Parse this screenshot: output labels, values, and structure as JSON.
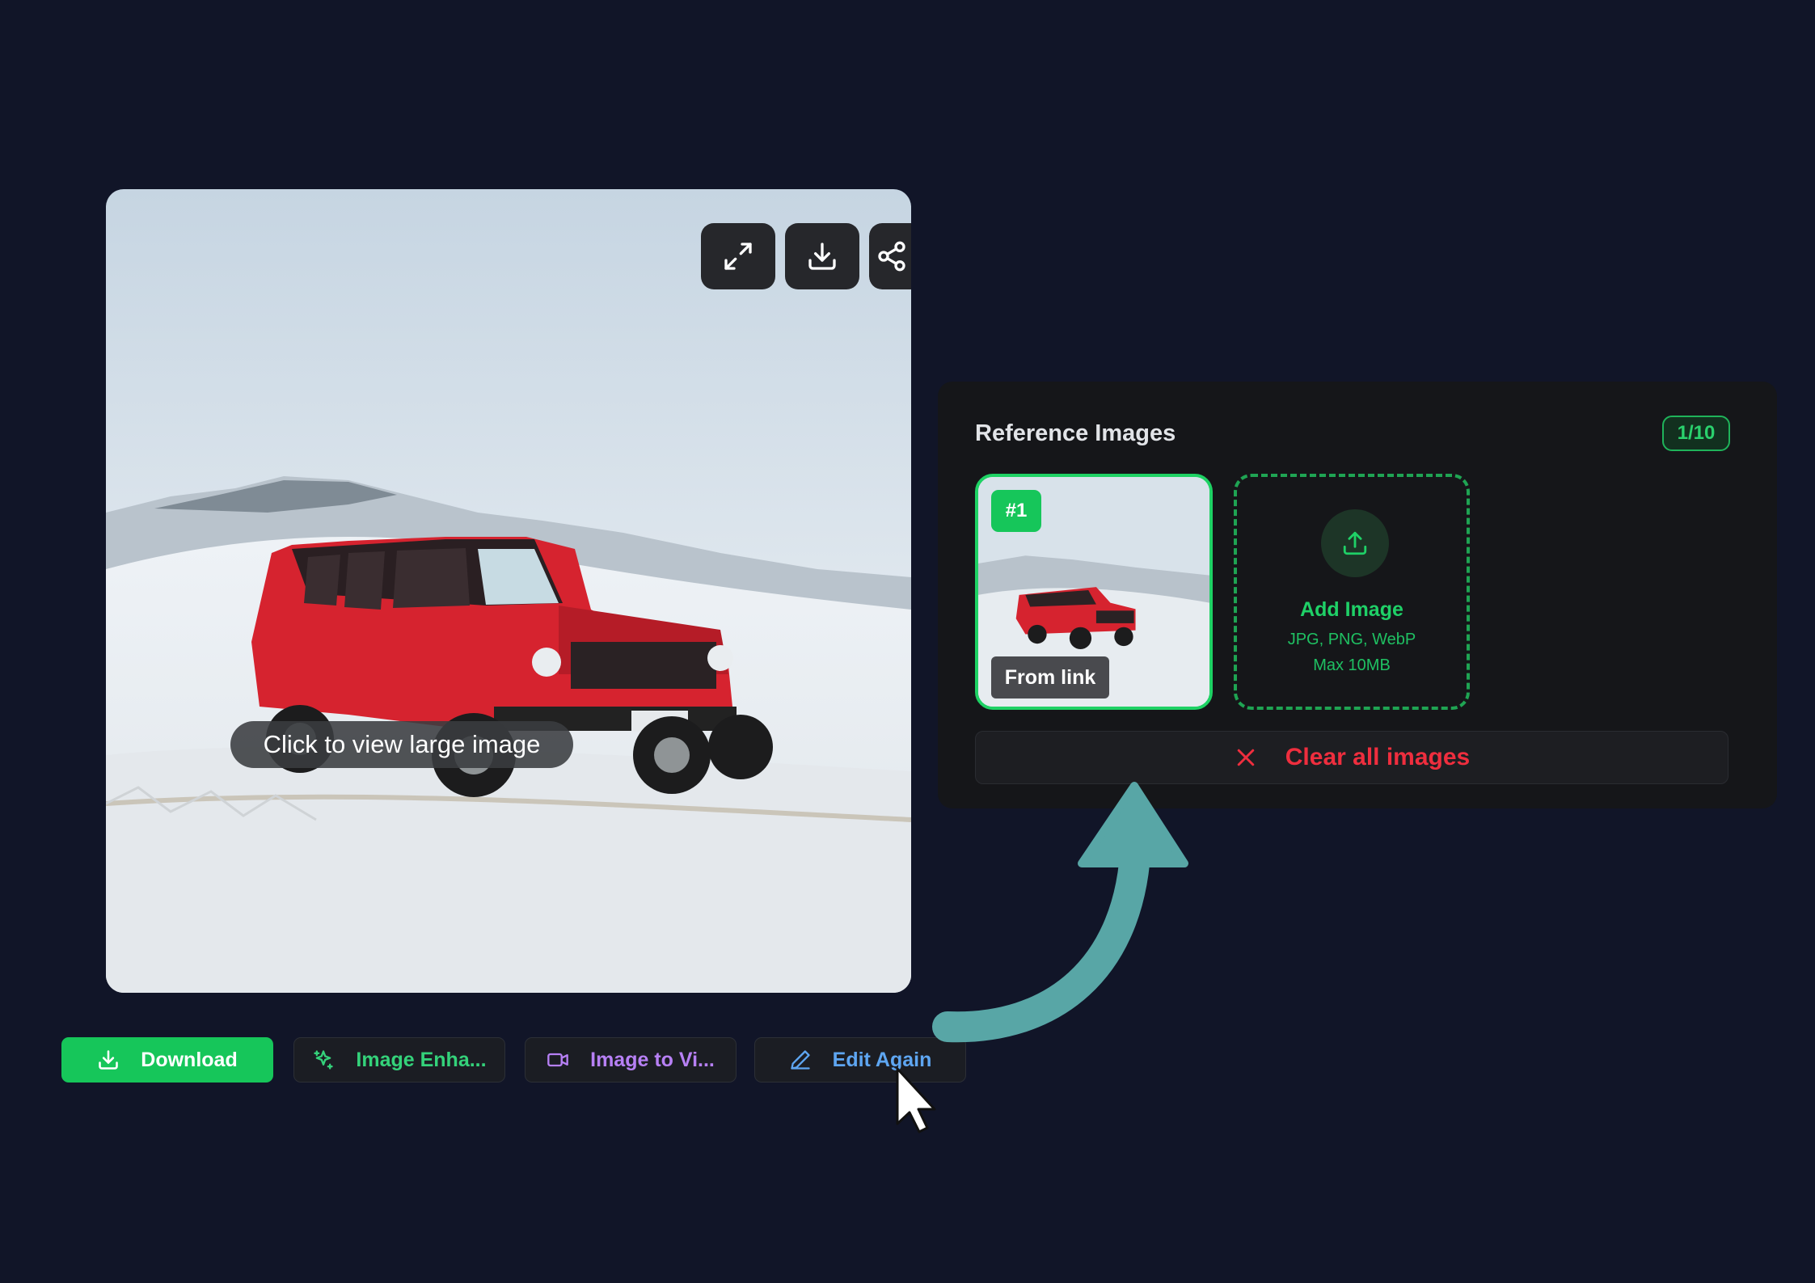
{
  "main_image": {
    "view_label": "Click to view large image",
    "tools": [
      {
        "icon": "expand-icon"
      },
      {
        "icon": "download-icon"
      },
      {
        "icon": "share-icon"
      }
    ]
  },
  "actions": [
    {
      "label": "Download",
      "icon": "download-icon"
    },
    {
      "label": "Image Enha...",
      "icon": "sparkle-icon"
    },
    {
      "label": "Image to Vi...",
      "icon": "video-icon"
    },
    {
      "label": "Edit Again",
      "icon": "pencil-icon"
    }
  ],
  "reference_panel": {
    "title": "Reference Images",
    "count": "1/10",
    "thumbnail": {
      "index": "#1",
      "source_label": "From link"
    },
    "add_tile": {
      "label": "Add Image",
      "formats": "JPG, PNG, WebP",
      "max_size": "Max 10MB"
    },
    "clear_label": "Clear all images"
  },
  "colors": {
    "background": "#111528",
    "accent_green": "#16c65a",
    "danger_red": "#ef2e3e",
    "arrow_teal": "#58a6a6",
    "enhance_green": "#34d27a",
    "video_purple": "#b780f5",
    "edit_blue": "#5ea6f2"
  }
}
